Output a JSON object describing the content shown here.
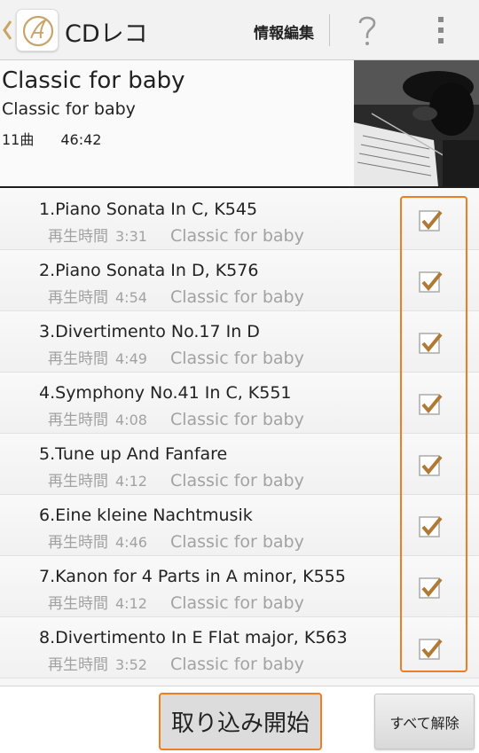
{
  "header": {
    "title": "CDレコ",
    "edit_label": "情報編集"
  },
  "album": {
    "title": "Classic for baby",
    "artist": "Classic for baby",
    "track_count": "11曲",
    "total_time": "46:42"
  },
  "tracks": [
    {
      "title": "1.Piano Sonata In C, K545",
      "time_label": "再生時間",
      "duration": "3:31",
      "artist": "Classic for baby",
      "checked": true
    },
    {
      "title": "2.Piano Sonata In D, K576",
      "time_label": "再生時間",
      "duration": "4:54",
      "artist": "Classic for baby",
      "checked": true
    },
    {
      "title": "3.Divertimento No.17 In D",
      "time_label": "再生時間",
      "duration": "4:49",
      "artist": "Classic for baby",
      "checked": true
    },
    {
      "title": "4.Symphony No.41 In C, K551",
      "time_label": "再生時間",
      "duration": "4:08",
      "artist": "Classic for baby",
      "checked": true
    },
    {
      "title": "5.Tune up And Fanfare",
      "time_label": "再生時間",
      "duration": "4:12",
      "artist": "Classic for baby",
      "checked": true
    },
    {
      "title": "6.Eine kleine Nachtmusik",
      "time_label": "再生時間",
      "duration": "4:46",
      "artist": "Classic for baby",
      "checked": true
    },
    {
      "title": "7.Kanon for 4 Parts in A minor, K555",
      "time_label": "再生時間",
      "duration": "4:12",
      "artist": "Classic for baby",
      "checked": true
    },
    {
      "title": "8.Divertimento In E Flat major, K563",
      "time_label": "再生時間",
      "duration": "3:52",
      "artist": "Classic for baby",
      "checked": true
    }
  ],
  "footer": {
    "import_label": "取り込み開始",
    "deselect_label": "すべて解除"
  },
  "colors": {
    "accent": "#ef7d22",
    "check": "#b07a35",
    "secondary_text": "#a2a2a2"
  },
  "icons": {
    "back": "chevron-left-icon",
    "logo": "app-logo-icon",
    "help": "question-mark-icon",
    "overflow": "overflow-menu-icon",
    "check": "checkbox-checked-icon"
  }
}
